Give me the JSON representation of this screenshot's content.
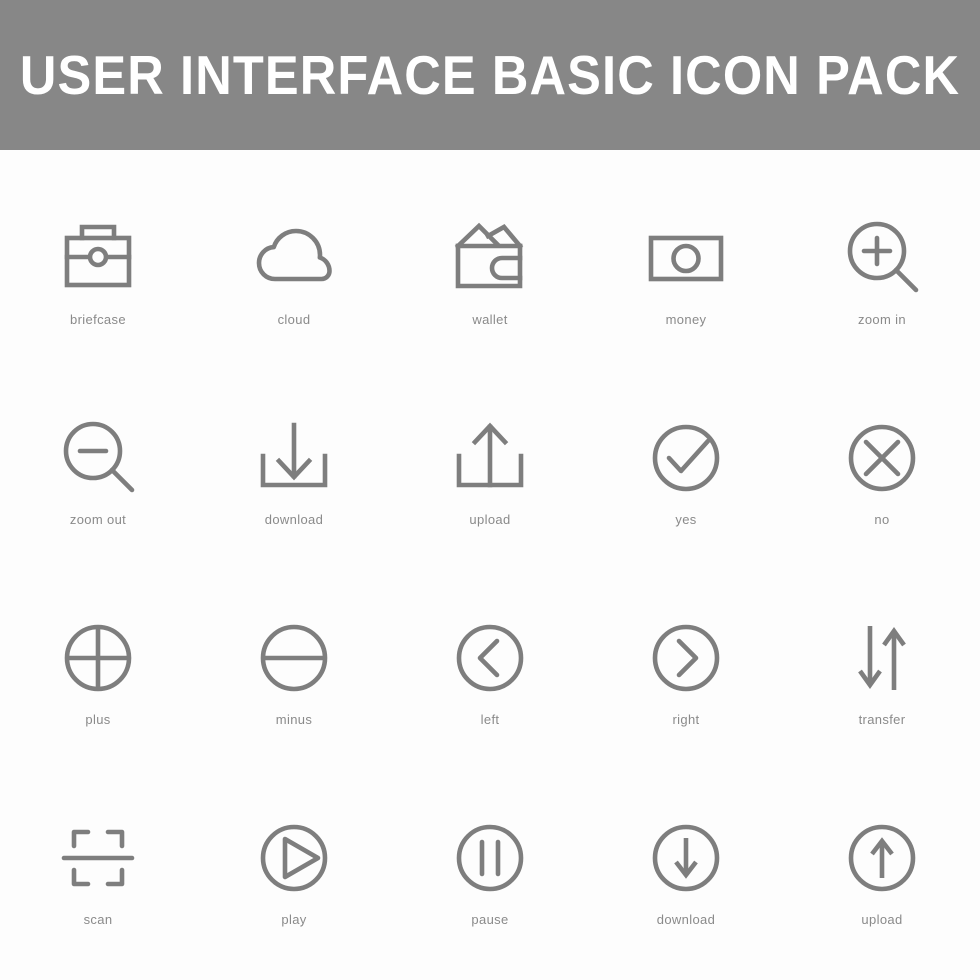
{
  "header": {
    "title": "USER INTERFACE BASIC ICON PACK",
    "background_color": "#878787",
    "text_color": "#ffffff"
  },
  "page": {
    "background_color": "#fdfdfd",
    "icon_stroke_color": "#7e7e7e",
    "label_color": "#8a8a8a",
    "columns": 5,
    "rows": 4
  },
  "icons": [
    {
      "label": "briefcase",
      "icon": "briefcase-icon"
    },
    {
      "label": "cloud",
      "icon": "cloud-icon"
    },
    {
      "label": "wallet",
      "icon": "wallet-icon"
    },
    {
      "label": "money",
      "icon": "money-icon"
    },
    {
      "label": "zoom in",
      "icon": "zoom-in-icon"
    },
    {
      "label": "zoom out",
      "icon": "zoom-out-icon"
    },
    {
      "label": "download",
      "icon": "download-tray-icon"
    },
    {
      "label": "upload",
      "icon": "upload-tray-icon"
    },
    {
      "label": "yes",
      "icon": "check-circle-icon"
    },
    {
      "label": "no",
      "icon": "x-circle-icon"
    },
    {
      "label": "plus",
      "icon": "plus-circle-icon"
    },
    {
      "label": "minus",
      "icon": "minus-circle-icon"
    },
    {
      "label": "left",
      "icon": "chevron-left-circle-icon"
    },
    {
      "label": "right",
      "icon": "chevron-right-circle-icon"
    },
    {
      "label": "transfer",
      "icon": "transfer-arrows-icon"
    },
    {
      "label": "scan",
      "icon": "scan-icon"
    },
    {
      "label": "play",
      "icon": "play-circle-icon"
    },
    {
      "label": "pause",
      "icon": "pause-circle-icon"
    },
    {
      "label": "download",
      "icon": "download-circle-icon"
    },
    {
      "label": "upload",
      "icon": "upload-circle-icon"
    }
  ]
}
